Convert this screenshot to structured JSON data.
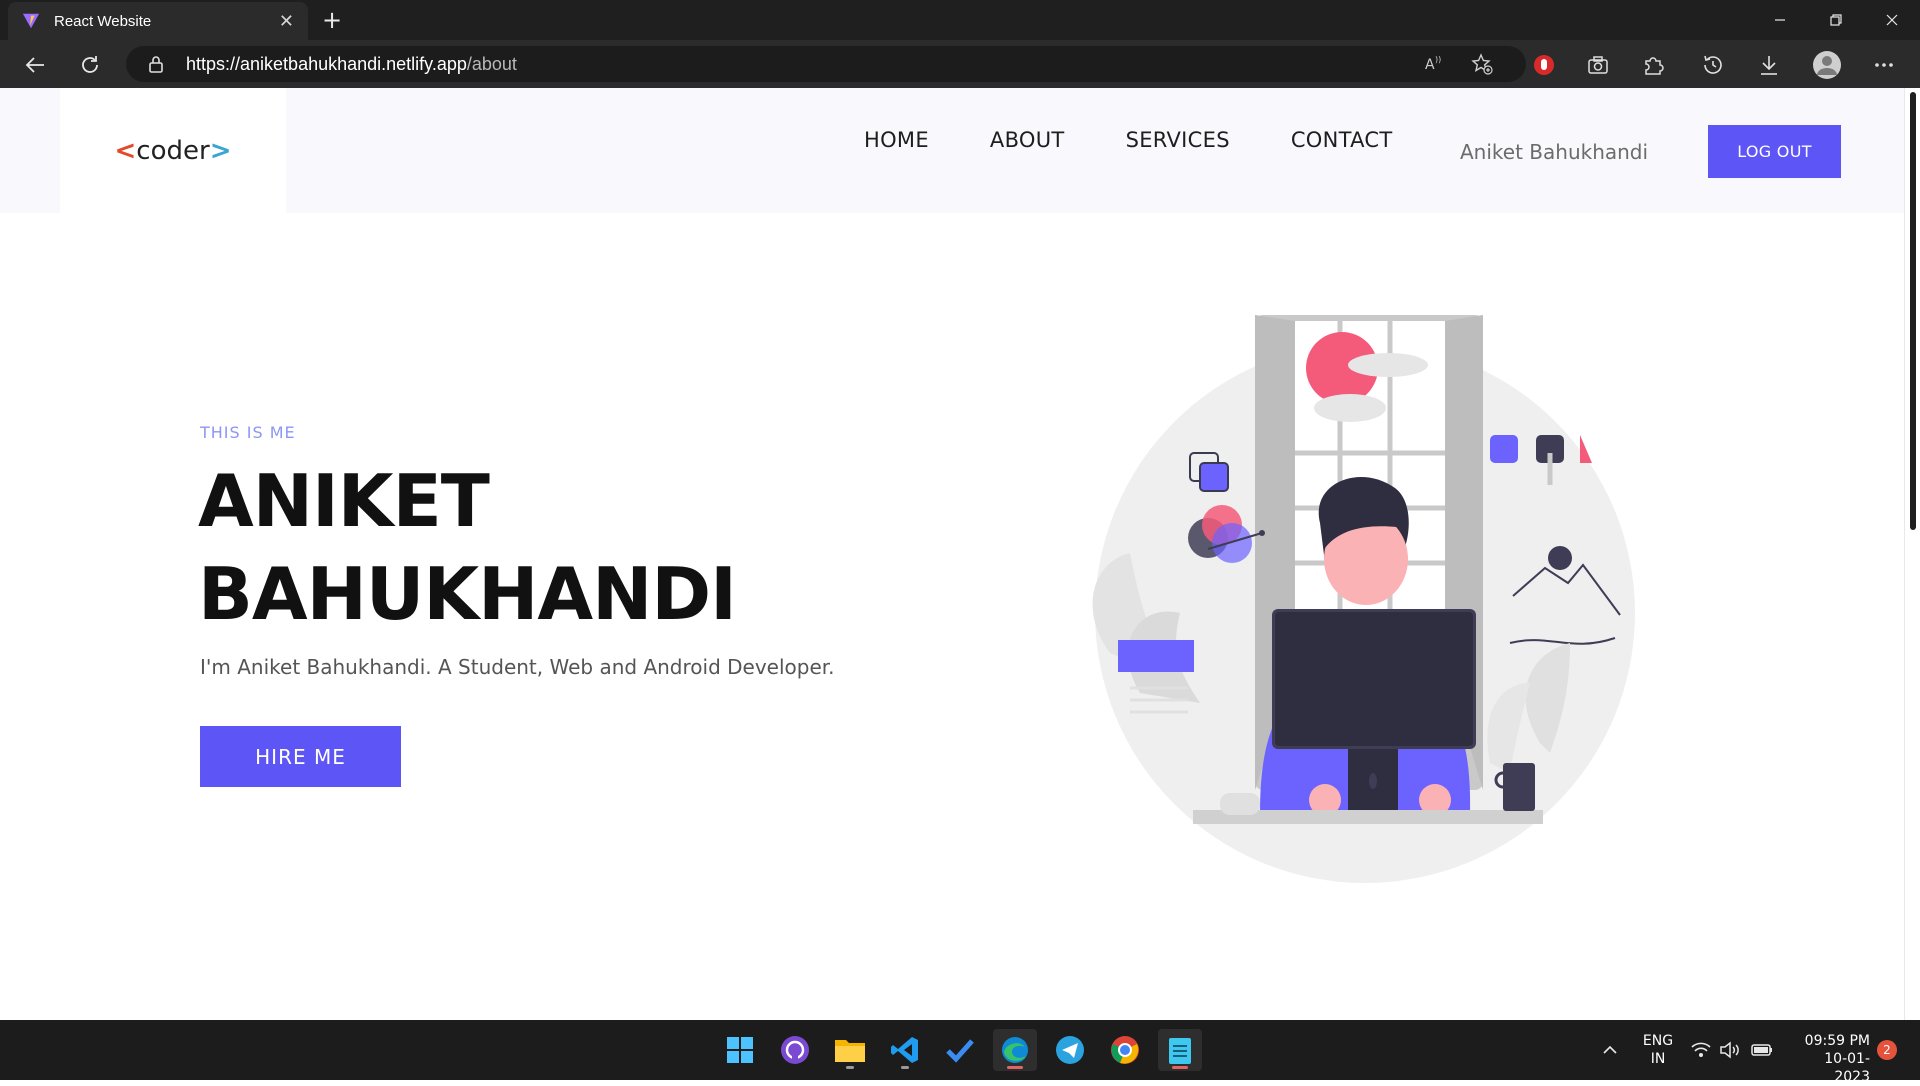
{
  "browser": {
    "tab_title": "React Website",
    "url_host": "https://aniketbahukhandi.netlify.app",
    "url_path": "/about"
  },
  "page": {
    "logo_lt": "<",
    "logo_text": "coder",
    "logo_gt": ">",
    "nav": [
      "HOME",
      "ABOUT",
      "SERVICES",
      "CONTACT"
    ],
    "user_name": "Aniket Bahukhandi",
    "logout_label": "LOG OUT",
    "kicker": "THIS IS ME",
    "name_line1": "ANIKET",
    "name_line2": "BAHUKHANDI",
    "description": "I'm Aniket Bahukhandi. A Student, Web and Android Developer.",
    "hire_label": "HIRE ME"
  },
  "taskbar": {
    "lang_line1": "ENG",
    "lang_line2": "IN",
    "time": "09:59 PM",
    "date": "10-01-2023",
    "notification_count": "2"
  },
  "colors": {
    "accent": "#5d55f6",
    "kicker": "#8d96f3",
    "nav_bg": "#f8f8fd"
  }
}
